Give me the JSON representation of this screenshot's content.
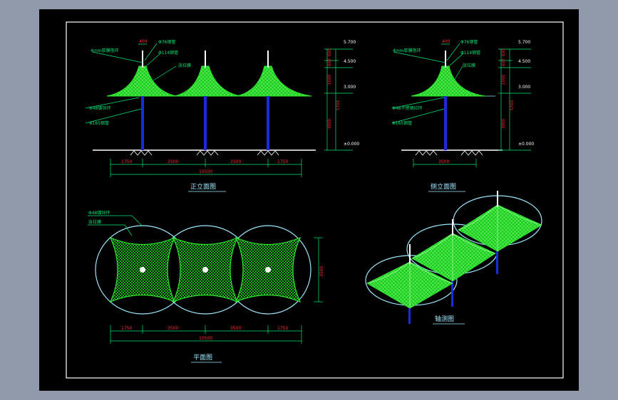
{
  "front_elevation": {
    "title": "正立面图",
    "callouts": [
      "4mm厚膜抱环",
      "Φ76钢管",
      "Φ114钢管",
      "张拉膜",
      "Φ48镀锌环",
      "Φ165钢管"
    ],
    "top_dim": "400",
    "dims_bottom": [
      "1750",
      "3500",
      "3500",
      "1750"
    ],
    "total_dim": "10500",
    "levels": [
      "5.700",
      "4.500",
      "3.000",
      "±0.000"
    ],
    "vert_dims": [
      "600",
      "600",
      "1500",
      "3000",
      "5700"
    ]
  },
  "side_elevation": {
    "title": "侧立面图",
    "callouts": [
      "4mm厚膜抱环",
      "Φ76钢管",
      "Φ114钢管",
      "张拉膜",
      "Φ48不锈钢拉环",
      "Φ165钢管"
    ],
    "top_dim": "400",
    "dims_bottom": [
      "3500"
    ],
    "levels": [
      "5.700",
      "4.500",
      "3.000",
      "±0.000"
    ],
    "vert_dims": [
      "600",
      "600",
      "1500",
      "3000",
      "5700"
    ]
  },
  "plan": {
    "title": "平面图",
    "callouts": [
      "Φ48镀锌环",
      "张拉膜"
    ],
    "side_dim": "3500",
    "dims_bottom": [
      "1750",
      "3500",
      "3500",
      "1750"
    ],
    "total_dim": "10500"
  },
  "axonometric": {
    "title": "轴测图"
  },
  "colors": {
    "membrane": "#2ee82e",
    "dim": "#00e676",
    "text_red": "#ff2a2a",
    "ring": "#9ee8ff",
    "column": "#1a2bd9"
  }
}
